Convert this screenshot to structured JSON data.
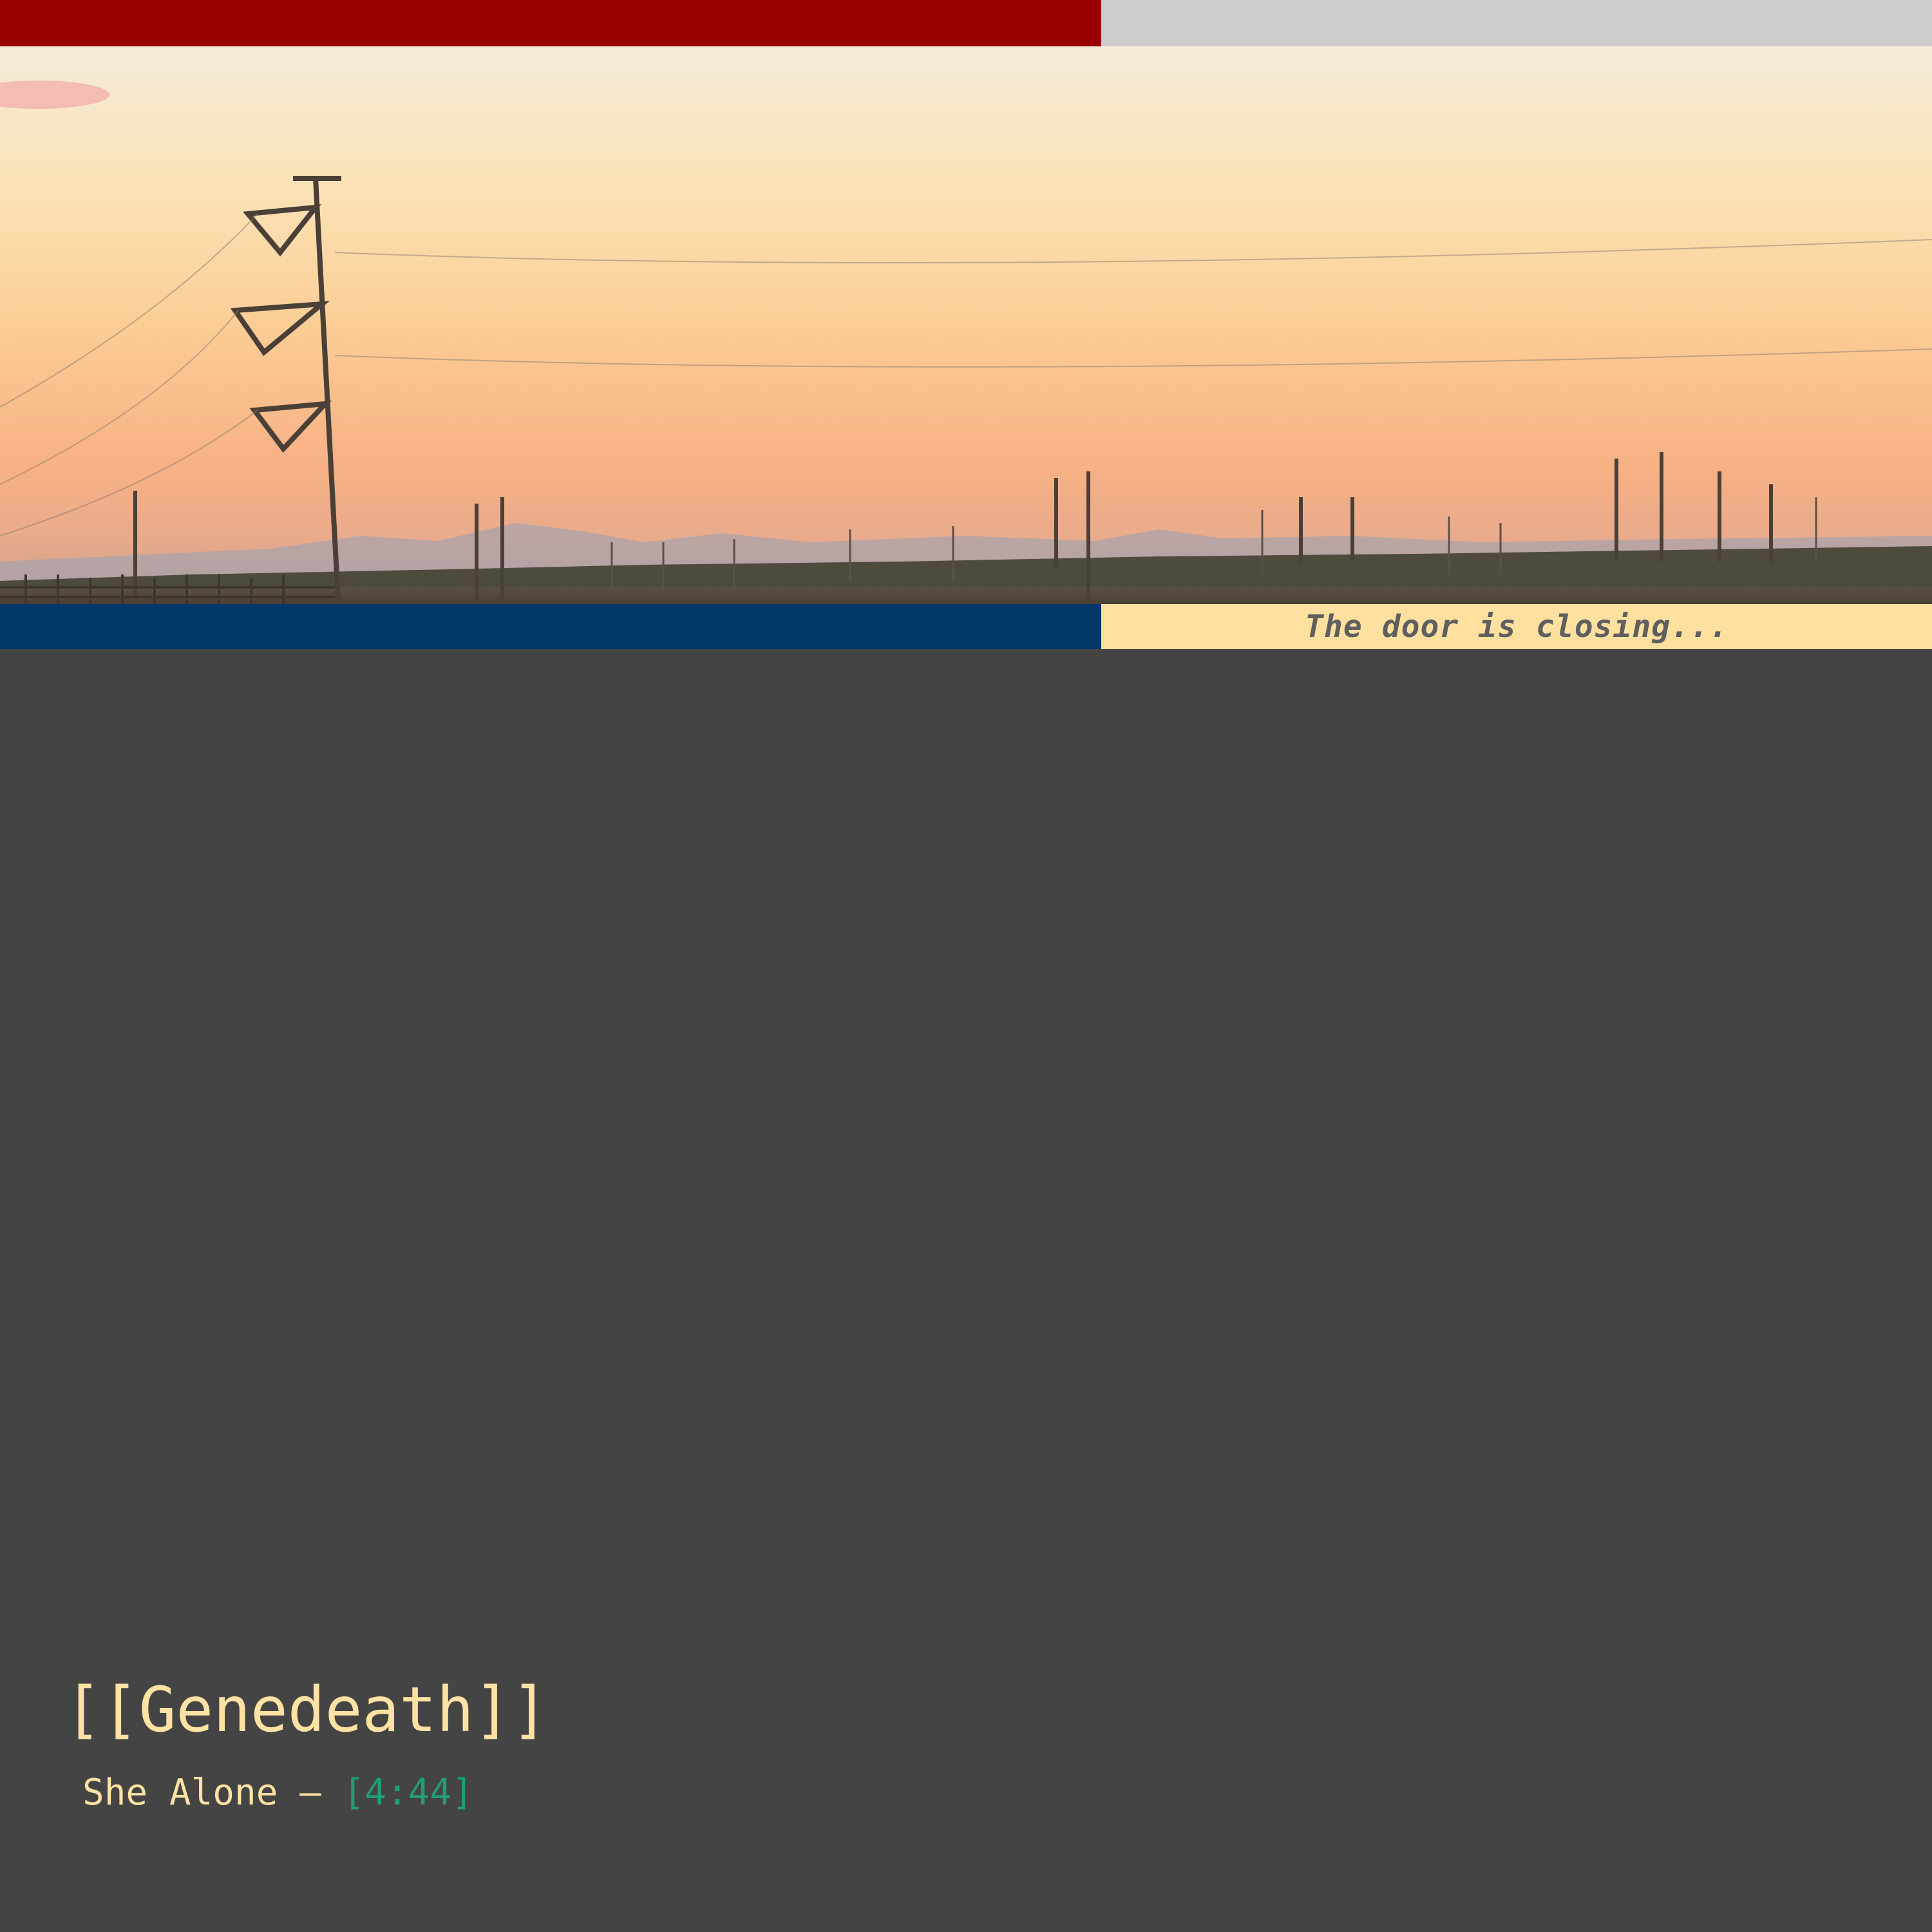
{
  "header": {
    "colors": {
      "left": "#990000",
      "right": "#cccccc"
    }
  },
  "hero": {
    "description_icon": "sunset-power-lines-image"
  },
  "banner": {
    "tagline": "The door is closing...",
    "colors": {
      "left": "#04376a",
      "right": "#ffe09e",
      "text": "#5f5f5f"
    }
  },
  "track": {
    "artist": "[[Genedeath]]",
    "title": "She Alone",
    "separator": "–",
    "duration": "[4:44]",
    "colors": {
      "text": "#ffe2a4",
      "duration": "#1f9e78",
      "background": "#444444"
    }
  }
}
